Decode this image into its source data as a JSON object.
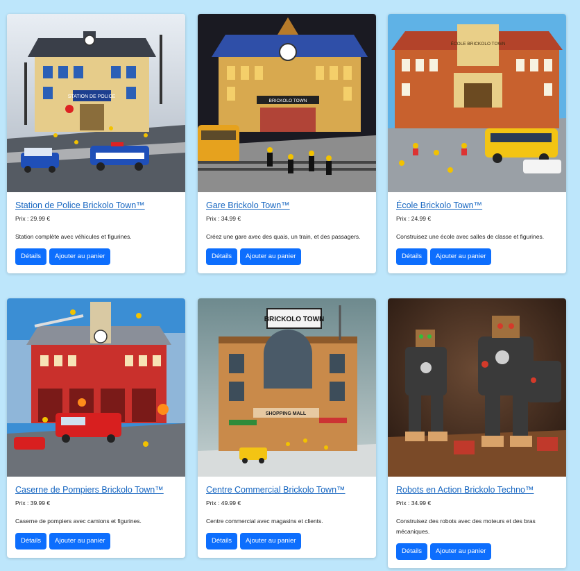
{
  "products": [
    {
      "title": "Station de Police Brickolo Town™",
      "price": "Prix : 29.99 €",
      "description": "Station complète avec véhicules et figurines.",
      "details_label": "Détails",
      "cart_label": "Ajouter au panier",
      "image_sign": "STATION DE POLICE"
    },
    {
      "title": "Gare Brickolo Town™",
      "price": "Prix : 34.99 €",
      "description": "Créez une gare avec des quais, un train, et des passagers.",
      "details_label": "Détails",
      "cart_label": "Ajouter au panier",
      "image_sign": "BRICKOLO TOWN"
    },
    {
      "title": "École Brickolo Town™",
      "price": "Prix : 24.99 €",
      "description": "Construisez une école avec salles de classe et figurines.",
      "details_label": "Détails",
      "cart_label": "Ajouter au panier",
      "image_sign": "ÉCOLE BRICKOLO TOWN"
    },
    {
      "title": "Caserne de Pompiers Brickolo Town™",
      "price": "Prix : 39.99 €",
      "description": "Caserne de pompiers avec camions et figurines.",
      "details_label": "Détails",
      "cart_label": "Ajouter au panier",
      "image_sign": ""
    },
    {
      "title": "Centre Commercial Brickolo Town™",
      "price": "Prix : 49.99 €",
      "description": "Centre commercial avec magasins et clients.",
      "details_label": "Détails",
      "cart_label": "Ajouter au panier",
      "image_sign": "BRICKOLO TOWN",
      "image_sign_2": "SHOPPING MALL"
    },
    {
      "title": "Robots en Action Brickolo Techno™",
      "price": "Prix : 34.99 €",
      "description": "Construisez des robots avec des moteurs et des bras mécaniques.",
      "details_label": "Détails",
      "cart_label": "Ajouter au panier",
      "image_sign": ""
    }
  ],
  "colors": {
    "page_background": "#bde6fb",
    "button": "#0d6efd",
    "link": "#1565c0"
  }
}
